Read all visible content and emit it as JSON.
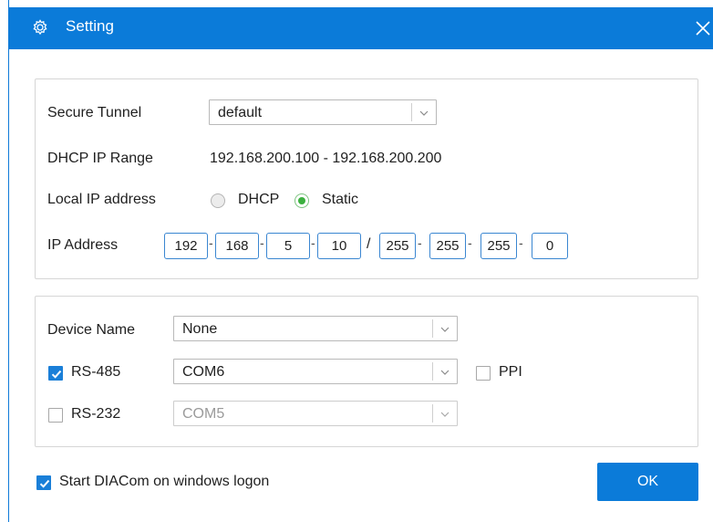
{
  "window": {
    "title": "Setting",
    "accent": "#0b7bd9"
  },
  "network": {
    "secure_tunnel_label": "Secure Tunnel",
    "secure_tunnel_value": "default",
    "dhcp_range_label": "DHCP IP Range",
    "dhcp_range_value": "192.168.200.100 - 192.168.200.200",
    "local_ip_label": "Local IP address",
    "radio_dhcp_label": "DHCP",
    "radio_static_label": "Static",
    "selected_mode": "Static",
    "ip_address_label": "IP Address",
    "ip_octets": [
      "192",
      "168",
      "5",
      "10"
    ],
    "separator": "/",
    "mask_octets": [
      "255",
      "255",
      "255",
      "0"
    ]
  },
  "device": {
    "device_name_label": "Device Name",
    "device_name_value": "None",
    "rs485_label": "RS-485",
    "rs485_checked": true,
    "rs485_port": "COM6",
    "ppi_label": "PPI",
    "ppi_checked": false,
    "rs232_label": "RS-232",
    "rs232_checked": false,
    "rs232_port": "COM5"
  },
  "footer": {
    "startup_label": "Start DIACom on windows logon",
    "startup_checked": true,
    "ok_label": "OK"
  },
  "icons": {
    "title": "gear-icon",
    "close": "close-icon",
    "dropdown": "chevron-down-icon",
    "check": "checkmark-icon"
  }
}
